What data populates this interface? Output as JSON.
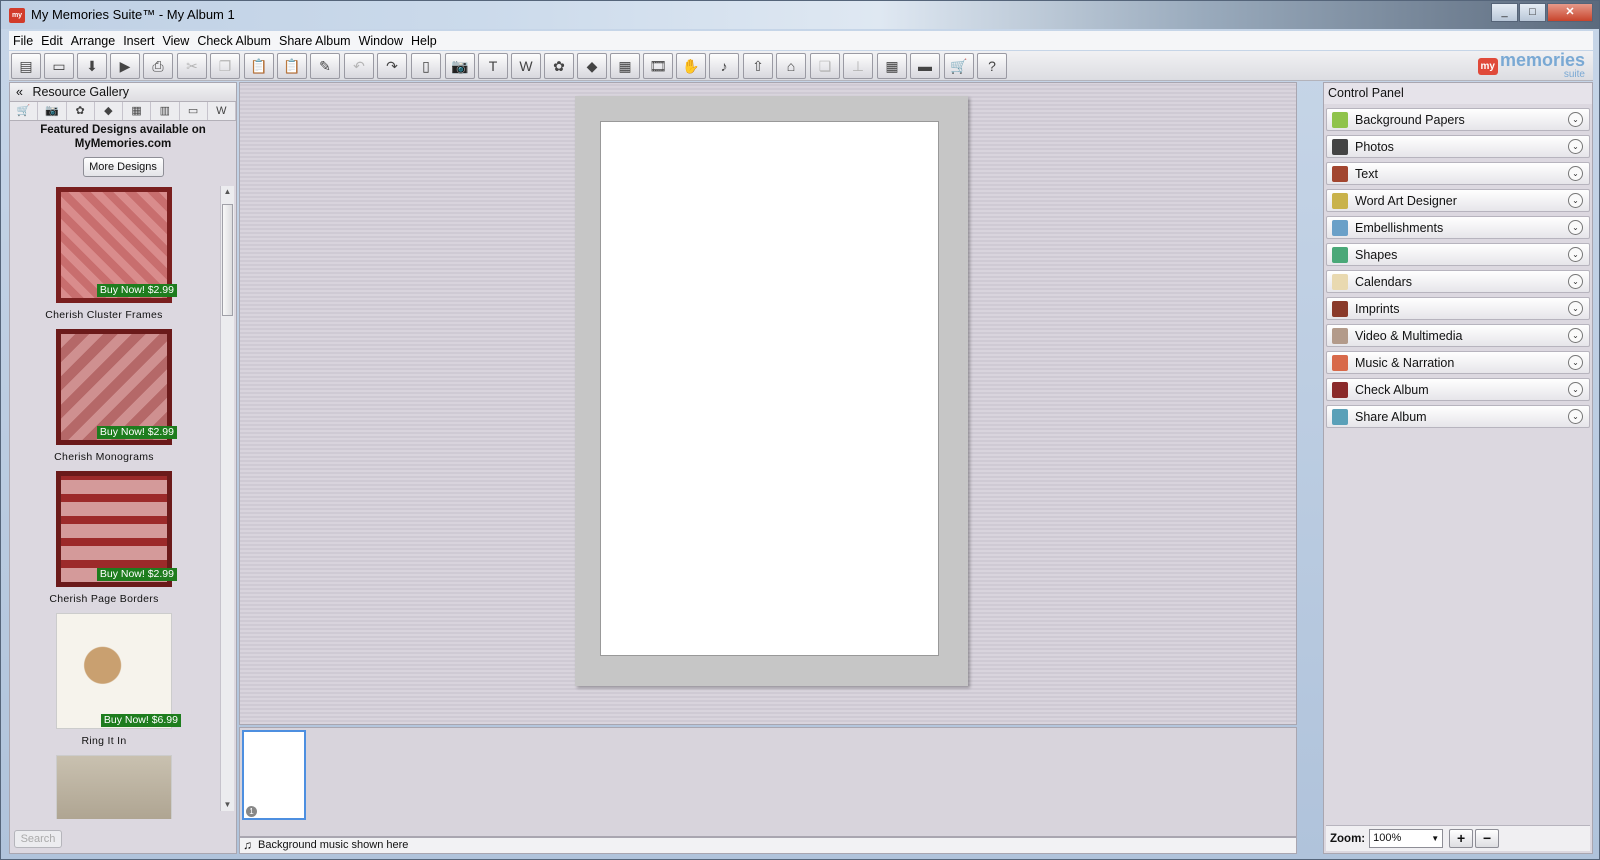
{
  "window": {
    "title": "My Memories Suite™ - My Album 1",
    "app_icon": "my",
    "controls": [
      "_",
      "□",
      "✕"
    ]
  },
  "menu": [
    "File",
    "Edit",
    "Arrange",
    "Insert",
    "View",
    "Check Album",
    "Share Album",
    "Window",
    "Help"
  ],
  "toolbar": {
    "icons": [
      {
        "name": "new-album-icon",
        "glyph": "▤",
        "enabled": true
      },
      {
        "name": "open-icon",
        "glyph": "▭",
        "enabled": true
      },
      {
        "name": "save-icon",
        "glyph": "⬇",
        "enabled": true
      },
      {
        "name": "play-icon",
        "glyph": "▶",
        "enabled": true
      },
      {
        "name": "print-icon",
        "glyph": "⎙",
        "enabled": true
      },
      {
        "name": "cut-icon",
        "glyph": "✂",
        "enabled": false
      },
      {
        "name": "copy-icon",
        "glyph": "❐",
        "enabled": false
      },
      {
        "name": "paste-icon",
        "glyph": "📋",
        "enabled": true
      },
      {
        "name": "paste-special-icon",
        "glyph": "📋",
        "enabled": true
      },
      {
        "name": "tools-icon",
        "glyph": "✎",
        "enabled": true
      },
      {
        "name": "undo-icon",
        "glyph": "↶",
        "enabled": false
      },
      {
        "name": "redo-icon",
        "glyph": "↷",
        "enabled": true
      },
      {
        "name": "new-page-icon",
        "glyph": "▯",
        "enabled": true
      },
      {
        "name": "camera-icon",
        "glyph": "📷",
        "enabled": true
      },
      {
        "name": "text-tool-icon",
        "glyph": "T",
        "enabled": true
      },
      {
        "name": "word-art-icon",
        "glyph": "W",
        "enabled": true
      },
      {
        "name": "embellishment-icon",
        "glyph": "✿",
        "enabled": true
      },
      {
        "name": "shapes-icon",
        "glyph": "◆",
        "enabled": true
      },
      {
        "name": "imprint-icon",
        "glyph": "▦",
        "enabled": true
      },
      {
        "name": "video-icon",
        "glyph": "🎞",
        "enabled": true
      },
      {
        "name": "hand-icon",
        "glyph": "✋",
        "enabled": true
      },
      {
        "name": "music-icon",
        "glyph": "♪",
        "enabled": true
      },
      {
        "name": "bring-front-icon",
        "glyph": "⇧",
        "enabled": true
      },
      {
        "name": "send-back-icon",
        "glyph": "⌂",
        "enabled": true
      },
      {
        "name": "group-icon",
        "glyph": "❏",
        "enabled": false
      },
      {
        "name": "align-icon",
        "glyph": "⊥",
        "enabled": false
      },
      {
        "name": "grid-icon",
        "glyph": "▦",
        "enabled": true
      },
      {
        "name": "filmstrip-icon",
        "glyph": "▬",
        "enabled": true
      },
      {
        "name": "cart-icon",
        "glyph": "🛒",
        "enabled": true
      },
      {
        "name": "help-icon",
        "glyph": "?",
        "enabled": true
      }
    ],
    "logo_my": "my",
    "logo_text": "memories",
    "logo_sub": "suite"
  },
  "resource_gallery": {
    "title": "Resource Gallery",
    "collapse_glyph": "«",
    "tabs": [
      "🛒",
      "📷",
      "✿",
      "◆",
      "▦",
      "▥",
      "▭",
      "W"
    ],
    "featured_text": "Featured Designs available on MyMemories.com",
    "more_button": "More Designs",
    "items": [
      {
        "label": "Cherish Cluster Frames",
        "price": "Buy Now! $2.99",
        "style": "p1"
      },
      {
        "label": "Cherish Monograms",
        "price": "Buy Now! $2.99",
        "style": "p2"
      },
      {
        "label": "Cherish Page Borders",
        "price": "Buy Now! $2.99",
        "style": "p3"
      },
      {
        "label": "Ring It In",
        "price": "Buy Now! $6.99",
        "style": "p4"
      },
      {
        "label": "",
        "price": "",
        "style": "p5"
      }
    ],
    "search_button": "Search"
  },
  "workspace": {
    "page_number": "1",
    "music_text": "Background music shown here"
  },
  "control_panel": {
    "title": "Control Panel",
    "items": [
      {
        "label": "Background Papers",
        "icon": "background-papers-icon",
        "color": "#8fc34a"
      },
      {
        "label": "Photos",
        "icon": "photos-icon",
        "color": "#444444"
      },
      {
        "label": "Text",
        "icon": "text-icon",
        "color": "#a2452f"
      },
      {
        "label": "Word Art Designer",
        "icon": "word-art-icon",
        "color": "#c9b24a"
      },
      {
        "label": "Embellishments",
        "icon": "embellishments-icon",
        "color": "#6aa0c8"
      },
      {
        "label": "Shapes",
        "icon": "shapes-icon",
        "color": "#4aa878"
      },
      {
        "label": "Calendars",
        "icon": "calendars-icon",
        "color": "#e9d9b0"
      },
      {
        "label": "Imprints",
        "icon": "imprints-icon",
        "color": "#8a3a2a"
      },
      {
        "label": "Video & Multimedia",
        "icon": "video-icon",
        "color": "#b39a8a"
      },
      {
        "label": "Music & Narration",
        "icon": "music-icon",
        "color": "#d8694a"
      },
      {
        "label": "Check Album",
        "icon": "check-album-icon",
        "color": "#8a2a2a"
      },
      {
        "label": "Share Album",
        "icon": "share-album-icon",
        "color": "#5aa0b8"
      }
    ],
    "zoom_label": "Zoom:",
    "zoom_value": "100%",
    "zoom_in": "+",
    "zoom_out": "−"
  }
}
